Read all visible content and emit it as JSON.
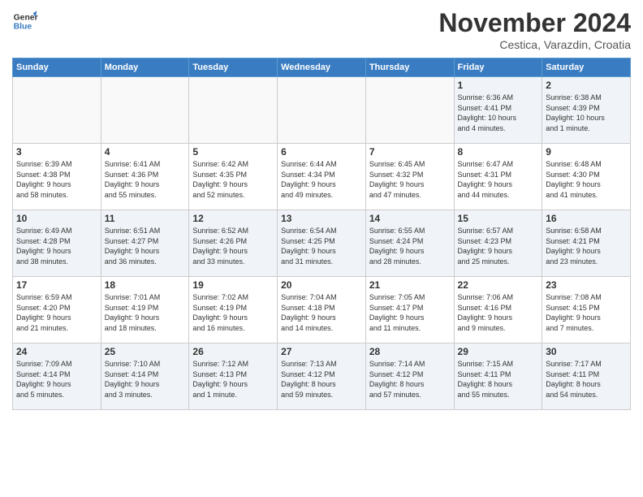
{
  "header": {
    "logo_line1": "General",
    "logo_line2": "Blue",
    "month": "November 2024",
    "location": "Cestica, Varazdin, Croatia"
  },
  "weekdays": [
    "Sunday",
    "Monday",
    "Tuesday",
    "Wednesday",
    "Thursday",
    "Friday",
    "Saturday"
  ],
  "weeks": [
    [
      {
        "day": "",
        "info": ""
      },
      {
        "day": "",
        "info": ""
      },
      {
        "day": "",
        "info": ""
      },
      {
        "day": "",
        "info": ""
      },
      {
        "day": "",
        "info": ""
      },
      {
        "day": "1",
        "info": "Sunrise: 6:36 AM\nSunset: 4:41 PM\nDaylight: 10 hours\nand 4 minutes."
      },
      {
        "day": "2",
        "info": "Sunrise: 6:38 AM\nSunset: 4:39 PM\nDaylight: 10 hours\nand 1 minute."
      }
    ],
    [
      {
        "day": "3",
        "info": "Sunrise: 6:39 AM\nSunset: 4:38 PM\nDaylight: 9 hours\nand 58 minutes."
      },
      {
        "day": "4",
        "info": "Sunrise: 6:41 AM\nSunset: 4:36 PM\nDaylight: 9 hours\nand 55 minutes."
      },
      {
        "day": "5",
        "info": "Sunrise: 6:42 AM\nSunset: 4:35 PM\nDaylight: 9 hours\nand 52 minutes."
      },
      {
        "day": "6",
        "info": "Sunrise: 6:44 AM\nSunset: 4:34 PM\nDaylight: 9 hours\nand 49 minutes."
      },
      {
        "day": "7",
        "info": "Sunrise: 6:45 AM\nSunset: 4:32 PM\nDaylight: 9 hours\nand 47 minutes."
      },
      {
        "day": "8",
        "info": "Sunrise: 6:47 AM\nSunset: 4:31 PM\nDaylight: 9 hours\nand 44 minutes."
      },
      {
        "day": "9",
        "info": "Sunrise: 6:48 AM\nSunset: 4:30 PM\nDaylight: 9 hours\nand 41 minutes."
      }
    ],
    [
      {
        "day": "10",
        "info": "Sunrise: 6:49 AM\nSunset: 4:28 PM\nDaylight: 9 hours\nand 38 minutes."
      },
      {
        "day": "11",
        "info": "Sunrise: 6:51 AM\nSunset: 4:27 PM\nDaylight: 9 hours\nand 36 minutes."
      },
      {
        "day": "12",
        "info": "Sunrise: 6:52 AM\nSunset: 4:26 PM\nDaylight: 9 hours\nand 33 minutes."
      },
      {
        "day": "13",
        "info": "Sunrise: 6:54 AM\nSunset: 4:25 PM\nDaylight: 9 hours\nand 31 minutes."
      },
      {
        "day": "14",
        "info": "Sunrise: 6:55 AM\nSunset: 4:24 PM\nDaylight: 9 hours\nand 28 minutes."
      },
      {
        "day": "15",
        "info": "Sunrise: 6:57 AM\nSunset: 4:23 PM\nDaylight: 9 hours\nand 25 minutes."
      },
      {
        "day": "16",
        "info": "Sunrise: 6:58 AM\nSunset: 4:21 PM\nDaylight: 9 hours\nand 23 minutes."
      }
    ],
    [
      {
        "day": "17",
        "info": "Sunrise: 6:59 AM\nSunset: 4:20 PM\nDaylight: 9 hours\nand 21 minutes."
      },
      {
        "day": "18",
        "info": "Sunrise: 7:01 AM\nSunset: 4:19 PM\nDaylight: 9 hours\nand 18 minutes."
      },
      {
        "day": "19",
        "info": "Sunrise: 7:02 AM\nSunset: 4:19 PM\nDaylight: 9 hours\nand 16 minutes."
      },
      {
        "day": "20",
        "info": "Sunrise: 7:04 AM\nSunset: 4:18 PM\nDaylight: 9 hours\nand 14 minutes."
      },
      {
        "day": "21",
        "info": "Sunrise: 7:05 AM\nSunset: 4:17 PM\nDaylight: 9 hours\nand 11 minutes."
      },
      {
        "day": "22",
        "info": "Sunrise: 7:06 AM\nSunset: 4:16 PM\nDaylight: 9 hours\nand 9 minutes."
      },
      {
        "day": "23",
        "info": "Sunrise: 7:08 AM\nSunset: 4:15 PM\nDaylight: 9 hours\nand 7 minutes."
      }
    ],
    [
      {
        "day": "24",
        "info": "Sunrise: 7:09 AM\nSunset: 4:14 PM\nDaylight: 9 hours\nand 5 minutes."
      },
      {
        "day": "25",
        "info": "Sunrise: 7:10 AM\nSunset: 4:14 PM\nDaylight: 9 hours\nand 3 minutes."
      },
      {
        "day": "26",
        "info": "Sunrise: 7:12 AM\nSunset: 4:13 PM\nDaylight: 9 hours\nand 1 minute."
      },
      {
        "day": "27",
        "info": "Sunrise: 7:13 AM\nSunset: 4:12 PM\nDaylight: 8 hours\nand 59 minutes."
      },
      {
        "day": "28",
        "info": "Sunrise: 7:14 AM\nSunset: 4:12 PM\nDaylight: 8 hours\nand 57 minutes."
      },
      {
        "day": "29",
        "info": "Sunrise: 7:15 AM\nSunset: 4:11 PM\nDaylight: 8 hours\nand 55 minutes."
      },
      {
        "day": "30",
        "info": "Sunrise: 7:17 AM\nSunset: 4:11 PM\nDaylight: 8 hours\nand 54 minutes."
      }
    ]
  ]
}
